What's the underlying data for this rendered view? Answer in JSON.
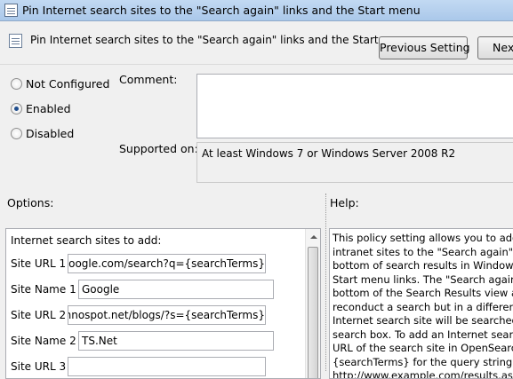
{
  "window": {
    "title": "Pin Internet search sites to the \"Search again\" links and the Start menu"
  },
  "header": {
    "title": "Pin Internet search sites to the \"Search again\" links and the Start menu",
    "prev_label": "Previous Setting",
    "next_label": "Next"
  },
  "state": {
    "options": [
      {
        "label": "Not Configured",
        "selected": false
      },
      {
        "label": "Enabled",
        "selected": true
      },
      {
        "label": "Disabled",
        "selected": false
      }
    ]
  },
  "comment": {
    "label": "Comment:",
    "value": ""
  },
  "supported": {
    "label": "Supported on:",
    "value": "At least Windows 7 or Windows Server 2008 R2"
  },
  "options_section": {
    "label": "Options:",
    "caption": "Internet search sites to add:",
    "rows": [
      {
        "label": "Site URL 1",
        "value": "http://www.google.com/search?q={searchTerms}"
      },
      {
        "label": "Site Name 1",
        "value": "Google"
      },
      {
        "label": "Site URL 2",
        "value": "http://www.technospot.net/blogs/?s={searchTerms}"
      },
      {
        "label": "Site Name 2",
        "value": "TS.Net"
      },
      {
        "label": "Site URL 3",
        "value": ""
      }
    ]
  },
  "help_section": {
    "label": "Help:",
    "lines": [
      "This policy setting allows you to add Internet or",
      "intranet sites to the \"Search again\" links located at the",
      "bottom of search results in Windows Explorer and the",
      "Start menu links. The \"Search again\" links at the",
      "bottom of the Search Results view allow the user to",
      "reconduct a search but in a different location. The",
      "Internet search site will be searched with the text in the",
      "search box.  To add an Internet search site, specify the",
      "URL of the search site in OpenSearch format with",
      "{searchTerms} for the query string (for example,",
      "http://www.example.com/results.aspx?q={searchTerms})."
    ]
  }
}
